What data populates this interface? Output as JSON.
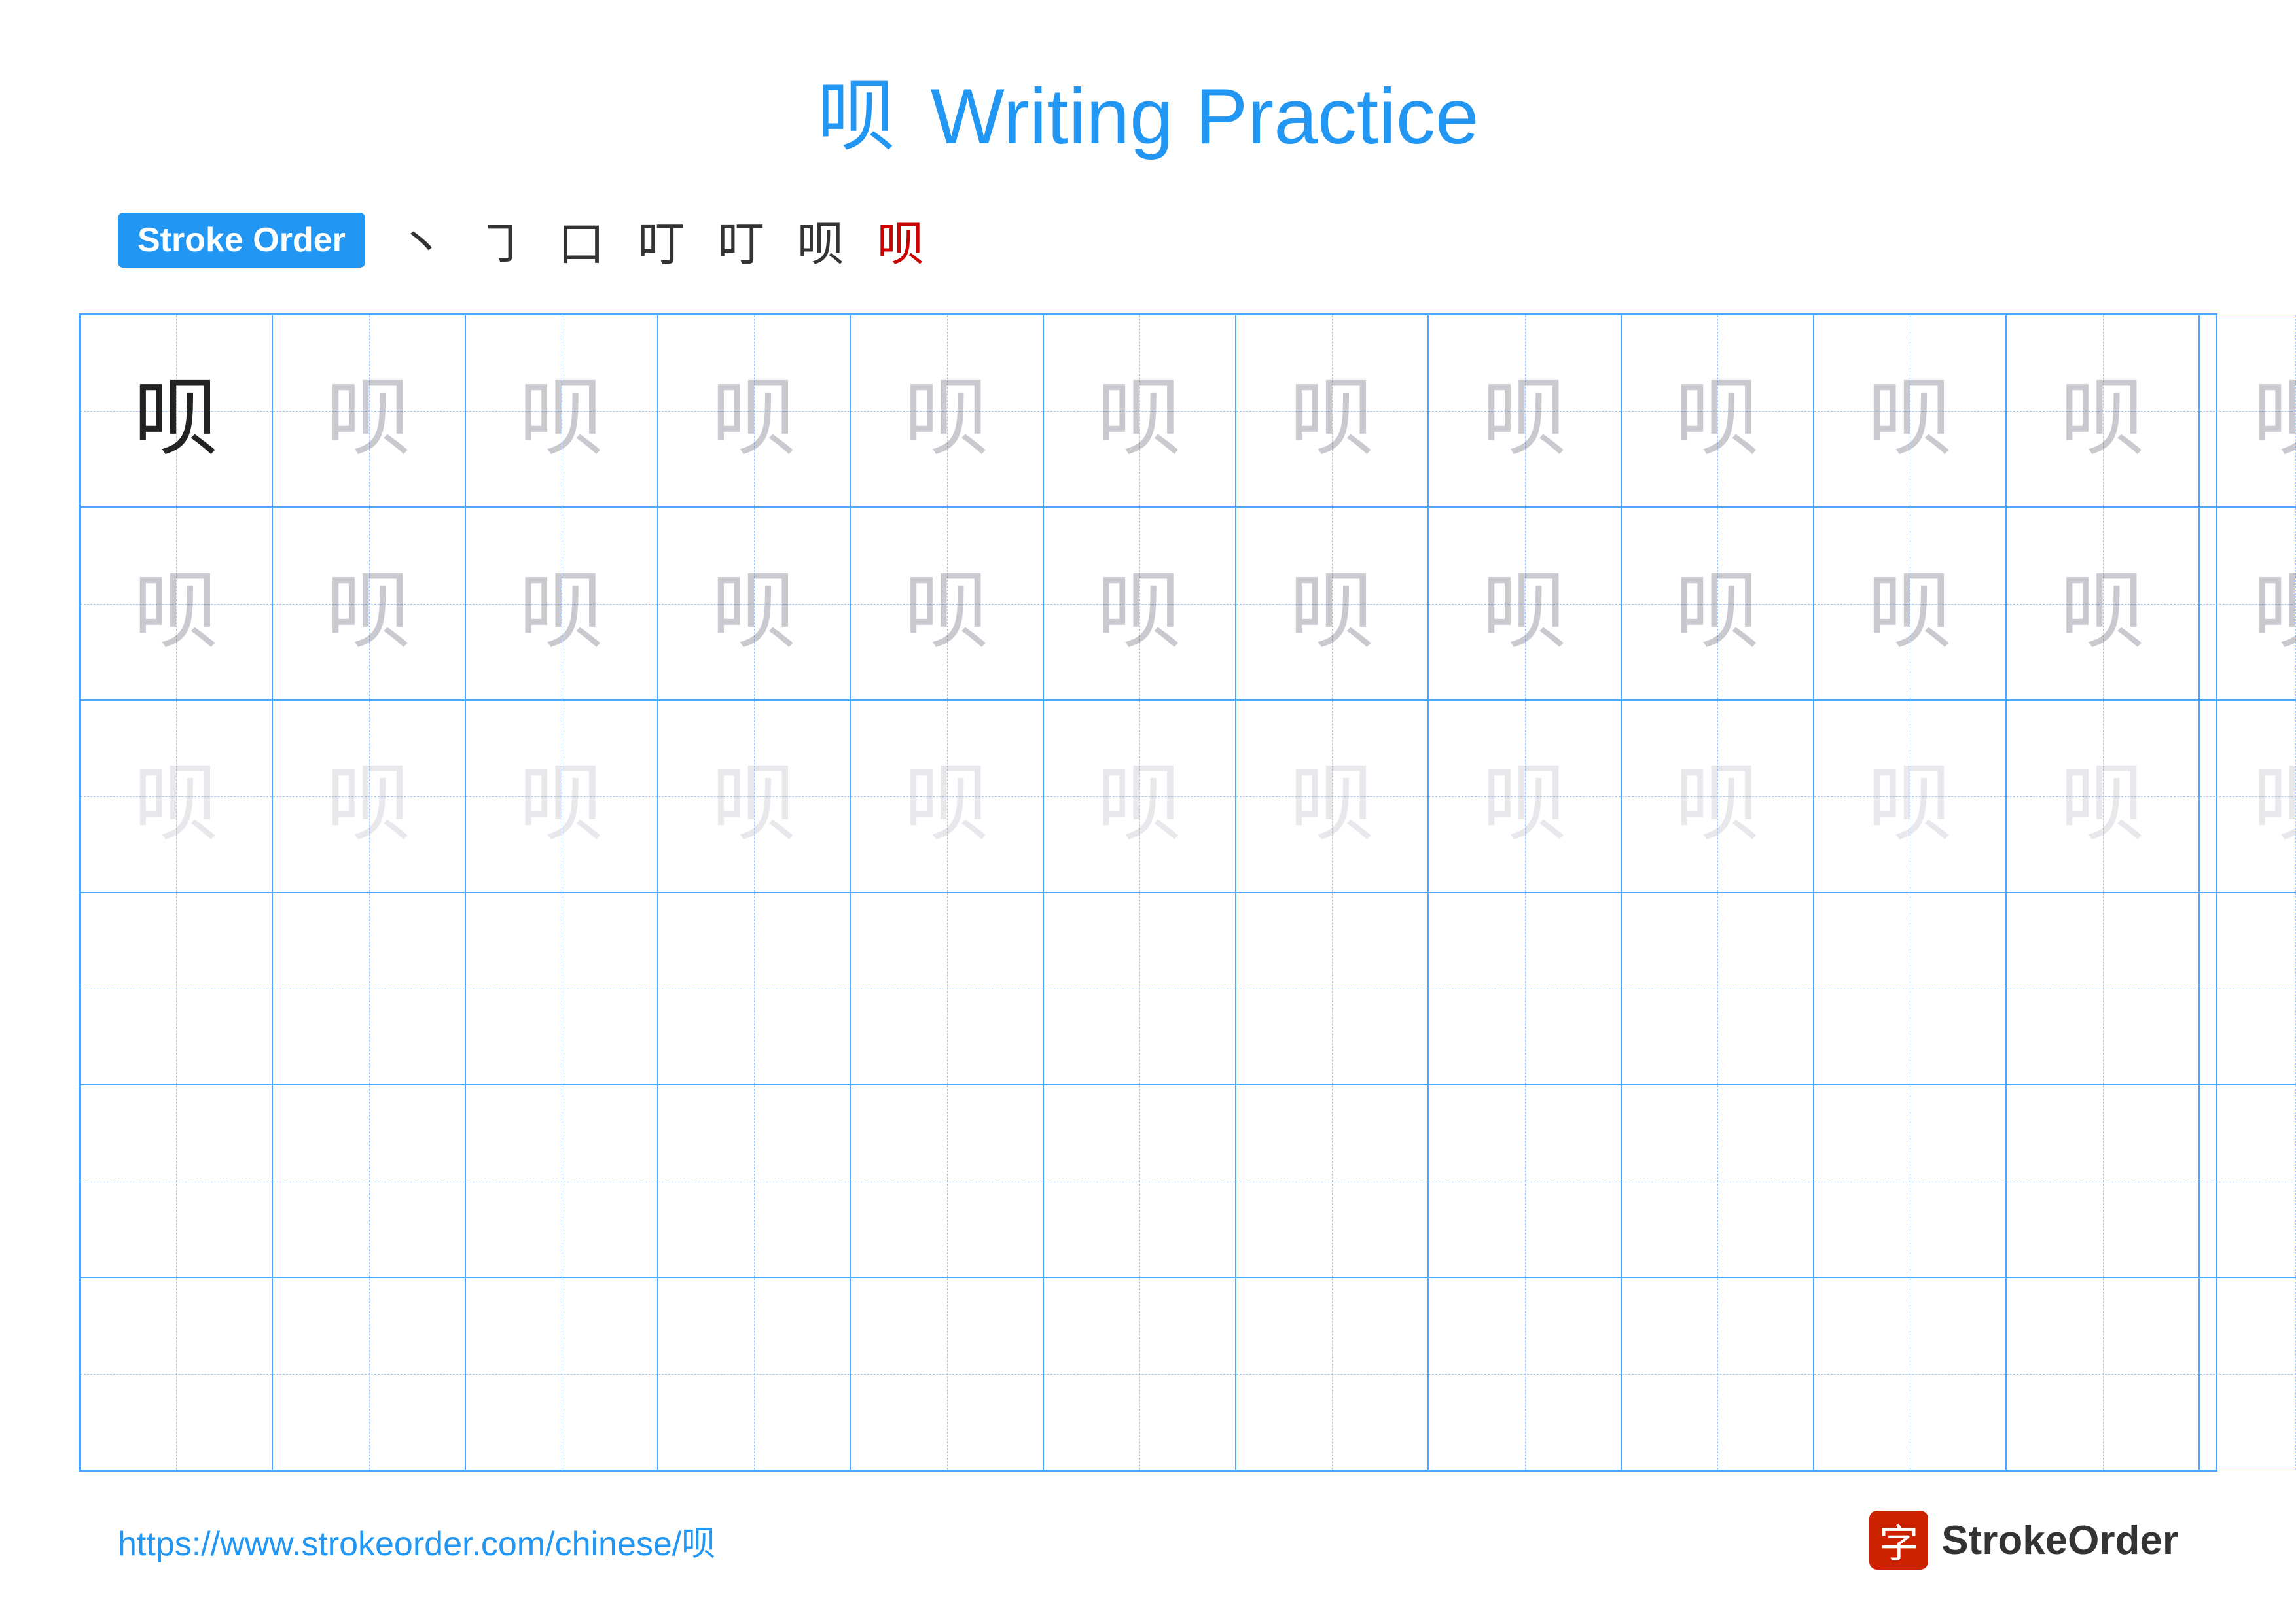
{
  "title": {
    "char": "呗",
    "text": "Writing Practice"
  },
  "stroke_order": {
    "badge_label": "Stroke Order",
    "steps": [
      "丶",
      "㇆",
      "口",
      "叮",
      "叮",
      "呗",
      "呗"
    ]
  },
  "grid": {
    "rows": 6,
    "cols": 13,
    "char": "呗"
  },
  "footer": {
    "url": "https://www.strokeorder.com/chinese/呗",
    "logo_char": "字",
    "logo_text": "StrokeOrder"
  }
}
